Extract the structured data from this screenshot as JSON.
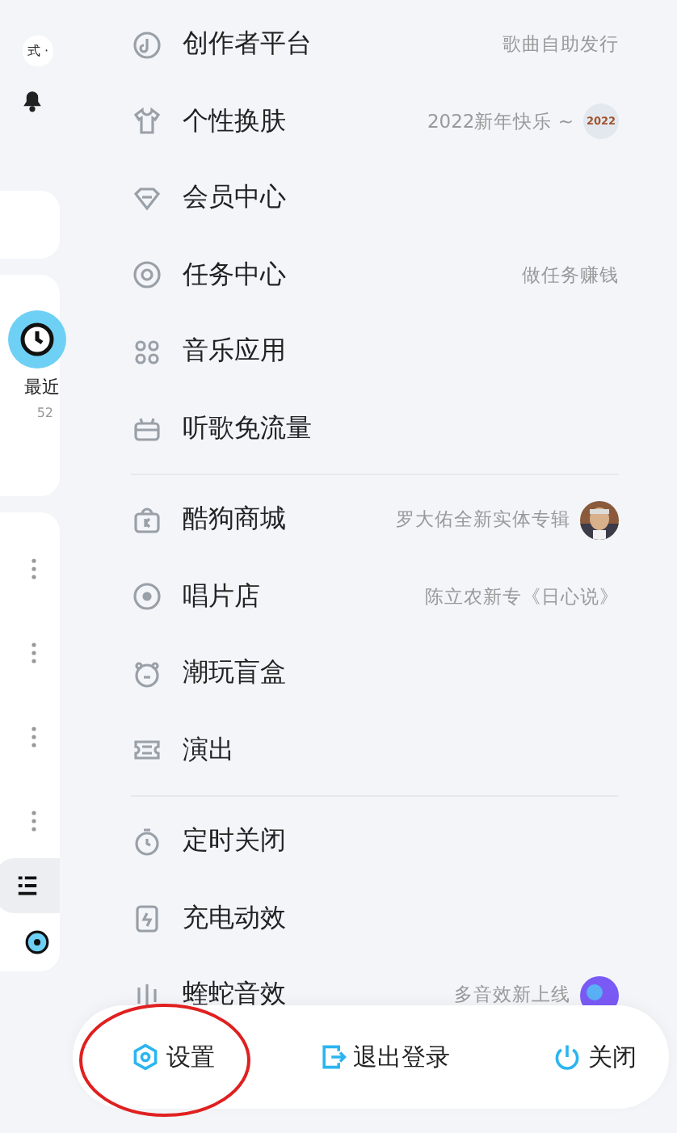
{
  "sidebar": {
    "mode_label": "式 ·",
    "recent_label": "最近",
    "recent_count": "52"
  },
  "sections": [
    {
      "items": [
        {
          "label": "创作者平台",
          "hint": "歌曲自助发行"
        },
        {
          "label": "个性换肤",
          "hint": "2022新年快乐 ~",
          "badge": "2022"
        },
        {
          "label": "会员中心"
        },
        {
          "label": "任务中心",
          "hint": "做任务赚钱"
        },
        {
          "label": "音乐应用"
        },
        {
          "label": "听歌免流量"
        }
      ]
    },
    {
      "items": [
        {
          "label": "酷狗商城",
          "hint": "罗大佑全新实体专辑"
        },
        {
          "label": "唱片店",
          "hint": "陈立农新专《日心说》"
        },
        {
          "label": "潮玩盲盒"
        },
        {
          "label": "演出"
        }
      ]
    },
    {
      "items": [
        {
          "label": "定时关闭"
        },
        {
          "label": "充电动效"
        },
        {
          "label": "蝰蛇音效",
          "hint": "多音效新上线",
          "thumb": {
            "kind": "orb"
          }
        }
      ]
    }
  ],
  "bottom_bar": [
    {
      "label": "设置",
      "highlighted": true
    },
    {
      "label": "退出登录",
      "highlighted": false
    },
    {
      "label": "关闭",
      "highlighted": false
    }
  ]
}
